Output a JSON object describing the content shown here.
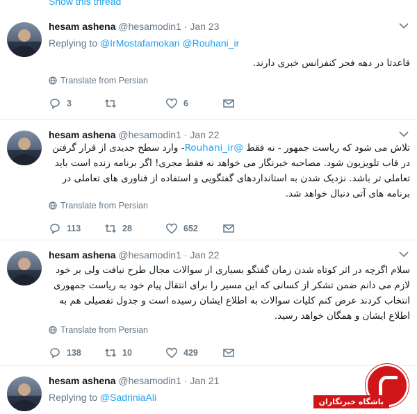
{
  "show_thread": "Show this thread",
  "tweets": [
    {
      "name": "hesam ashena",
      "handle": "@hesamodin1",
      "date": "· Jan 23",
      "replying_prefix": "Replying to",
      "replying_to": "@IrMostafamokari @Rouhani_ir",
      "text": "قاعدتا در دهه فجر کنفرانس خبری دارند.",
      "translate": "Translate from Persian",
      "replies": "3",
      "retweets": "",
      "likes": "6"
    },
    {
      "name": "hesam ashena",
      "handle": "@hesamodin1",
      "date": "· Jan 22",
      "text_before_mention": "تلاش می شود که ریاست جمهور - نه فقط ",
      "mention": "@Rouhani_ir",
      "text_after_mention": "- وارد سطح جدیدی از قرار گرفتن در قاب تلویزیون شود.  مصاحبه خبرنگار می خواهد نه فقط مجری! اگر برنامه زنده است باید تعاملی تر باشد. نزدیک شدن به استانداردهای گفتگویی و استفاده از فناوری های تعاملی در برنامه های آتی دنبال خواهد شد.",
      "translate": "Translate from Persian",
      "replies": "113",
      "retweets": "28",
      "likes": "652"
    },
    {
      "name": "hesam ashena",
      "handle": "@hesamodin1",
      "date": "· Jan 22",
      "text": "سلام اگرچه در اثر کوتاه شدن زمان گفتگو بسیاری از سوالات مجال طرح نیافت ولی بر خود لازم می دانم ضمن تشکر از کسانی که این مسیر را برای انتقال پیام خود به ریاست جمهوری انتخاب کردند عرض کنم کلیات سوالات به اطلاع ایشان رسیده است و جدول تفصیلی هم به اطلاع ایشان و همگان خواهد رسید.",
      "translate": "Translate from Persian",
      "replies": "138",
      "retweets": "10",
      "likes": "429"
    },
    {
      "name": "hesam ashena",
      "handle": "@hesamodin1",
      "date": "· Jan 21",
      "replying_prefix": "Replying to",
      "replying_to": "@SadriniaAli"
    }
  ],
  "watermark": "باشگاه خبرنگاران",
  "colors": {
    "link": "#1da1f2",
    "muted": "#657786",
    "divider": "#e6ecf0",
    "badge": "#d0161b"
  }
}
